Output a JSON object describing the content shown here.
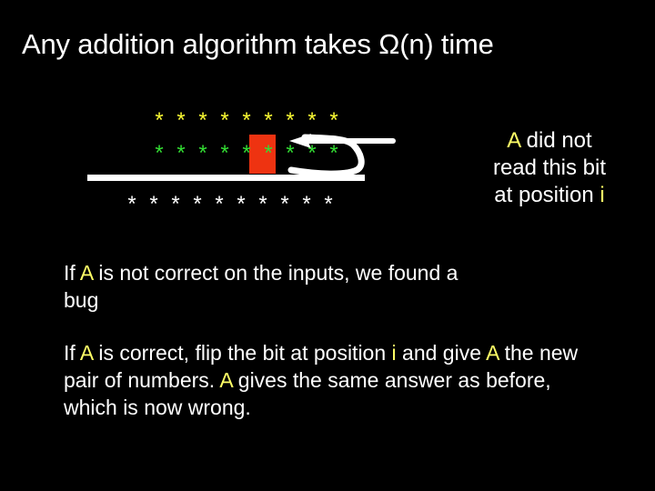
{
  "slide": {
    "background_color": "#000000",
    "title": "Any addition algorithm takes Ω(n) time"
  },
  "diagram": {
    "name": "binary-addition-star-diagram",
    "rows": [
      {
        "id": "operand-a",
        "color": "#ffff33",
        "color_name": "yellow",
        "symbol": "*",
        "count": 9
      },
      {
        "id": "operand-b",
        "color": "#33dd33",
        "color_name": "green",
        "symbol": "*",
        "count": 9
      },
      {
        "id": "sum",
        "color": "#ffffff",
        "color_name": "white",
        "symbol": "*",
        "count": 10
      }
    ],
    "highlight": {
      "color": "#ee3311",
      "row": "operand-b",
      "index": 6,
      "label": "unread-bit-highlight"
    },
    "rule_line": {
      "color": "#ffffff",
      "label": "addition-rule-line"
    },
    "arrow": {
      "color": "#ffffff",
      "label": "pointer-arrow",
      "direction": "right-to-left"
    }
  },
  "caption": {
    "line1_prefix": "",
    "line1_highlight": "A",
    "line1_rest": " did not",
    "line2": "read this bit",
    "line3_prefix": "at position ",
    "line3_highlight": "i",
    "highlight_color": "#ffff66"
  },
  "body": {
    "para1": {
      "seg1": "If ",
      "hl1": "A",
      "seg2": " is not correct on the inputs, we found a bug"
    },
    "para2": {
      "seg1": "If ",
      "hl1": "A",
      "seg2": " is correct, flip the bit at position ",
      "hl2": "i",
      "seg3": " and give ",
      "hl3": "A",
      "seg4": " the new pair of numbers. ",
      "hl4": "A",
      "seg5": " gives the same answer as before, which is now wrong."
    }
  }
}
